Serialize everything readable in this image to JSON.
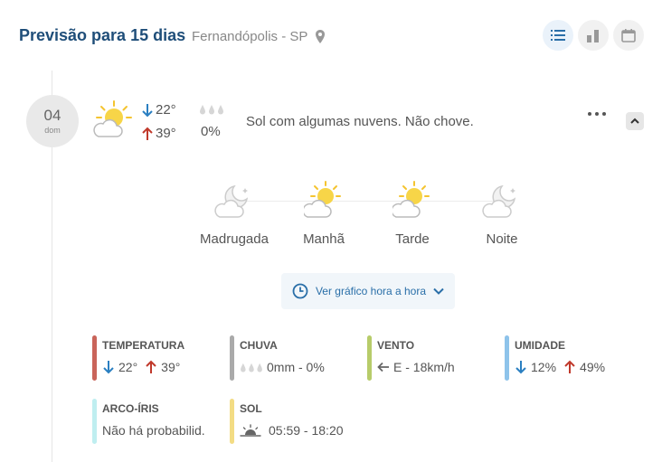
{
  "header": {
    "title": "Previsão para 15 dias",
    "city": "Fernandópolis - SP"
  },
  "day": {
    "date_number": "04",
    "weekday": "dom",
    "temp_min": "22°",
    "temp_max": "39°",
    "rain_probability": "0%",
    "summary": "Sol com algumas nuvens. Não chove."
  },
  "periods": [
    {
      "label": "Madrugada",
      "icon": "moon-cloud-icon"
    },
    {
      "label": "Manhã",
      "icon": "sun-cloud-icon"
    },
    {
      "label": "Tarde",
      "icon": "sun-cloud-icon"
    },
    {
      "label": "Noite",
      "icon": "moon-cloud-icon"
    }
  ],
  "hourly_button": "Ver gráfico hora a hora",
  "details": {
    "temperature": {
      "title": "TEMPERATURA",
      "min": "22°",
      "max": "39°",
      "color": "#c9645a"
    },
    "rain": {
      "title": "CHUVA",
      "value": "0mm - 0%",
      "color": "#aaaaaa"
    },
    "wind": {
      "title": "VENTO",
      "value": "E - 18km/h",
      "color": "#b7cc6a"
    },
    "humidity": {
      "title": "UMIDADE",
      "min": "12%",
      "max": "49%",
      "color": "#8ec3ea"
    },
    "rainbow": {
      "title": "ARCO-ÍRIS",
      "value": "Não há probabilid.",
      "color": "#bfeef0"
    },
    "sun": {
      "title": "SOL",
      "value": "05:59 - 18:20",
      "color": "#f3dc84"
    }
  },
  "colors": {
    "title_blue": "#1f4e79",
    "accent_blue": "#2a6fa8",
    "arrow_down": "#2a7fc1",
    "arrow_up": "#c0392b"
  }
}
